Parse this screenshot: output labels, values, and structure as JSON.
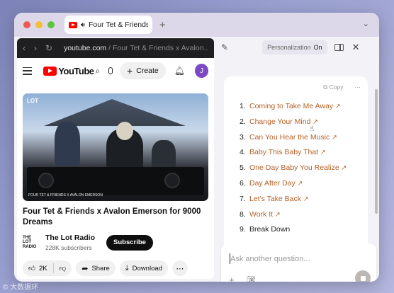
{
  "tab": {
    "title": "Four Tet & Friends"
  },
  "urlbar": {
    "domain": "youtube.com",
    "path": " / Four Tet & Friends x Avalon..."
  },
  "youtube": {
    "logo_text": "YouTube",
    "create_label": "Create",
    "avatar_letter": "J"
  },
  "video": {
    "title": "Four Tet & Friends x Avalon Emerson for 9000 Dreams",
    "thumb_overlay_label": "LOT",
    "thumb_bottom_text": "FOUR TET & FRIENDS X AVALON EMERSON"
  },
  "channel": {
    "logo_text": "THE LOT RADIO",
    "name": "The Lot Radio",
    "subscribers": "228K subscribers",
    "subscribe_label": "Subscribe"
  },
  "actions": {
    "likes": "2K",
    "share": "Share",
    "download": "Download"
  },
  "assistant": {
    "personalization_label": "Personalization",
    "personalization_state": "On",
    "copy_label": "Copy",
    "tracks": [
      {
        "num": "1.",
        "title": "Coming to Take Me Away",
        "link": true
      },
      {
        "num": "2.",
        "title": "Change Your Mind",
        "link": true
      },
      {
        "num": "3.",
        "title": "Can You Hear the Music",
        "link": true
      },
      {
        "num": "4.",
        "title": "Baby This Baby That",
        "link": true
      },
      {
        "num": "5.",
        "title": "One Day Baby You Realize",
        "link": true
      },
      {
        "num": "6.",
        "title": "Day After Day",
        "link": true
      },
      {
        "num": "7.",
        "title": "Let's Take Back",
        "link": true
      },
      {
        "num": "8.",
        "title": "Work It",
        "link": true
      },
      {
        "num": "9.",
        "title": "Break Down",
        "link": false
      }
    ],
    "ask_placeholder": "Ask another question..."
  },
  "watermark": "© 大数据环"
}
